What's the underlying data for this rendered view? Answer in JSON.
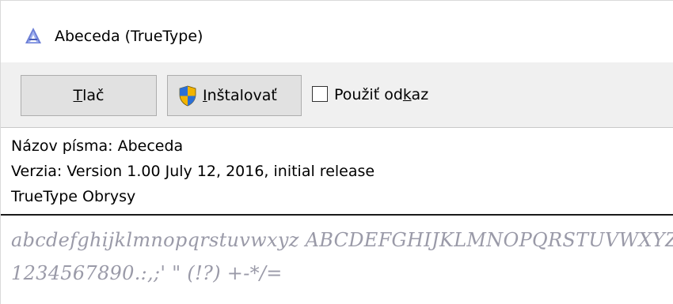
{
  "window": {
    "title": "Abeceda (TrueType)",
    "title_icon": "font-viewer-icon"
  },
  "toolbar": {
    "print_label_underlined": "T",
    "print_label_rest": "lač",
    "install_label_underlined": "I",
    "install_label_rest": "nštalovať",
    "install_icon": "uac-shield-icon",
    "use_link_label_before": "Použiť od",
    "use_link_label_underlined": "k",
    "use_link_label_after": "az",
    "use_link_checked": false
  },
  "info": {
    "font_name_line": "Názov písma: Abeceda",
    "version_line": "Verzia: Version 1.00 July 12, 2016, initial release",
    "outline_line": "TrueType Obrysy"
  },
  "sample": {
    "line1": "abcdefghijklmnopqrstuvwxyz ABCDEFGHIJKLMNOPQRSTUVWXYZ",
    "line2": "1234567890.:,;' \" (!?) +-*/="
  },
  "colors": {
    "toolbar_bg": "#f0f0f0",
    "button_bg": "#e1e1e1",
    "button_border": "#adadad",
    "sample_text": "#9a9aa8"
  }
}
